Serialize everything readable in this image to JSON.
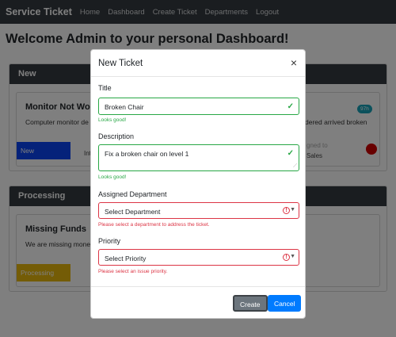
{
  "navbar": {
    "brand": "Service Ticket",
    "links": [
      "Home",
      "Dashboard",
      "Create Ticket",
      "Departments",
      "Logout"
    ]
  },
  "welcome": "Welcome Admin to your personal Dashboard!",
  "sections": {
    "new": {
      "header": "New",
      "ticket_title": "Monitor Not Wo",
      "ticket_desc": "Computer monitor de",
      "right_desc": "dered arrived broken",
      "badge": "97h",
      "status": "New",
      "assigned_partial": "Int",
      "assigned_to": "gned to",
      "dept": "Sales",
      "status_color": "#0b44f4",
      "dot_color": "#d00000"
    },
    "processing": {
      "header": "Processing",
      "ticket_title": "Missing Funds",
      "ticket_desc": "We are missing mone",
      "status": "Processing",
      "status_color": "#e8b80c"
    }
  },
  "modal": {
    "title": "New Ticket",
    "close": "×",
    "title_label": "Title",
    "title_value": "Broken Chair",
    "title_feedback": "Looks good!",
    "description_label": "Description",
    "description_value": "Fix a broken chair on level 1",
    "description_feedback": "Looks good!",
    "department_label": "Assigned Department",
    "department_value": "Select Department",
    "department_error": "Please select a department to address the ticket.",
    "priority_label": "Priority",
    "priority_value": "Select Priority",
    "priority_error": "Please select an issue priority.",
    "create_label": "Create",
    "cancel_label": "Cancel"
  }
}
